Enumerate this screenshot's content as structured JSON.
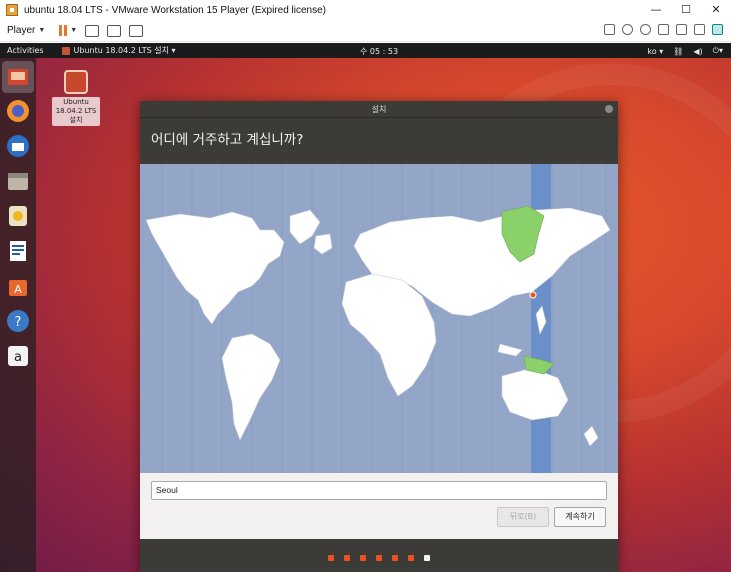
{
  "host": {
    "title": "ubuntu 18.04 LTS - VMware Workstation 15 Player (Expired license)",
    "window_buttons": [
      "—",
      "☐",
      "✕"
    ],
    "player_menu": "Player"
  },
  "guest_panel": {
    "activities": "Activities",
    "app_menu": "Ubuntu 18.04.2 LTS 설치 ▾",
    "clock": "수 05 : 53",
    "lang": "ko ▾"
  },
  "desktop_icon": {
    "label_line1": "Ubuntu",
    "label_line2": "18.04.2 LTS",
    "label_line3": "설치"
  },
  "installer": {
    "window_title": "설치",
    "heading": "어디에 거주하고 계십니까?",
    "timezone_value": "Seoul",
    "back_label": "뒤로(B)",
    "next_label": "계속하기",
    "step_count": 7,
    "current_step": 7
  },
  "colors": {
    "accent": "#e95420",
    "ocean": "#93a6c8",
    "land": "#ffffff",
    "timezone_band": "#6b90c8",
    "selected_region": "#8ad16a"
  },
  "dock": [
    "installer-icon",
    "firefox-icon",
    "thunderbird-icon",
    "files-icon",
    "rhythmbox-icon",
    "writer-icon",
    "software-icon",
    "help-icon",
    "amazon-icon"
  ]
}
